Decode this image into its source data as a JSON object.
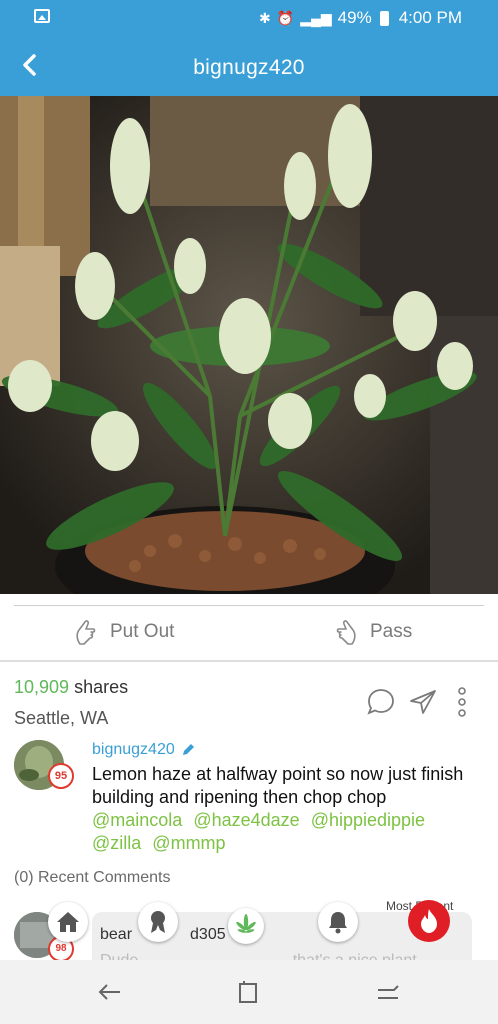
{
  "status_bar": {
    "battery": "49%",
    "time": "4:00 PM",
    "icons": [
      "gallery-icon",
      "bluetooth-icon",
      "alarm-icon",
      "lte-signal-icon",
      "battery-icon"
    ]
  },
  "app_bar": {
    "title": "bignugz420",
    "back_icon": "chevron-left-icon"
  },
  "actions": {
    "put_out_label": "Put Out",
    "pass_label": "Pass"
  },
  "stats": {
    "shares_count": "10,909",
    "shares_label": "shares",
    "location": "Seattle, WA"
  },
  "post": {
    "author": "bignugz420",
    "author_score": "95",
    "body": "Lemon haze at halfway point so now just finish building and ripening then chop chop",
    "tags": [
      "@maincola",
      "@haze4daze",
      "@hippiedippie",
      "@zilla",
      "@mmmp"
    ]
  },
  "comments": {
    "header": "(0) Recent Comments",
    "sort_label": "Most Recent",
    "first": {
      "author_visible": "bear",
      "author_suffix": "d305",
      "score": "98",
      "text_fragment": "Dude",
      "text_fragment_2": "that's a nice plant"
    }
  },
  "colors": {
    "brand": "#3a9fd6",
    "accent_green": "#7dc243",
    "count_green": "#5fb85a",
    "hot_red": "#e01e25"
  }
}
